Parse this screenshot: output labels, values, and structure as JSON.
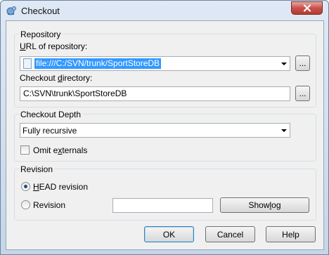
{
  "window": {
    "title": "Checkout",
    "close_label": "✕"
  },
  "repository": {
    "group_label": "Repository",
    "url_label": "URL of repository:",
    "url_value": "file:///C:/SVN/trunk/SportStoreDB",
    "browse_label": "...",
    "dir_label": "Checkout directory:",
    "dir_value": "C:\\SVN\\trunk\\SportStoreDB",
    "dir_browse_label": "..."
  },
  "depth": {
    "group_label": "Checkout Depth",
    "selected": "Fully recursive",
    "omit_externals_label": "Omit externals",
    "omit_externals_checked": false
  },
  "revision": {
    "group_label": "Revision",
    "head_label": "HEAD revision",
    "head_checked": true,
    "revision_label": "Revision",
    "revision_value": "",
    "show_log_label": "Show log"
  },
  "buttons": {
    "ok": "OK",
    "cancel": "Cancel",
    "help": "Help"
  }
}
